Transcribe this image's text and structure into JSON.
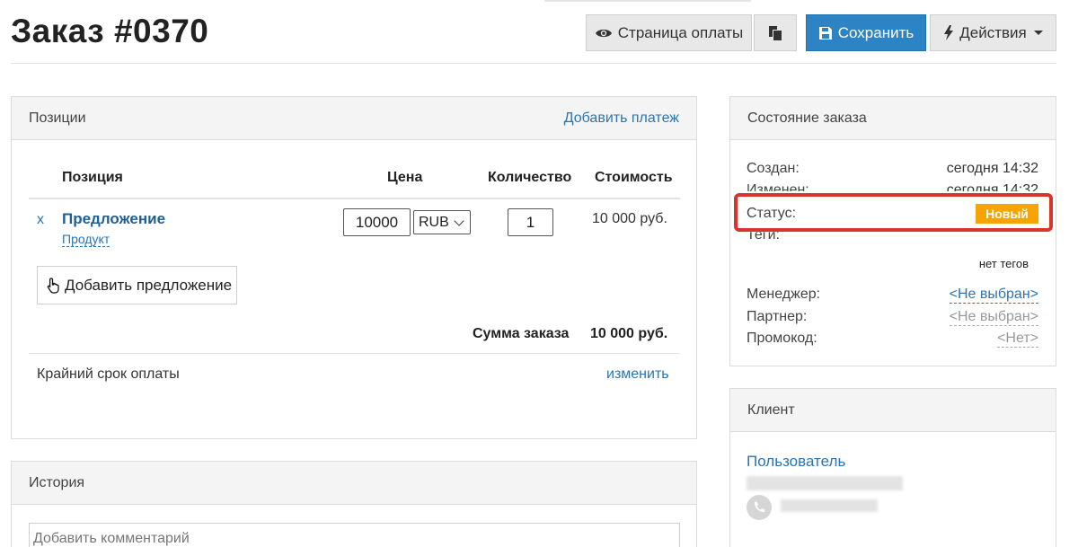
{
  "page": {
    "title": "Заказ #0370"
  },
  "toolbar": {
    "pay_page_label": "Страница оплаты",
    "save_label": "Сохранить",
    "actions_label": "Действия"
  },
  "items_panel": {
    "title": "Позиции",
    "add_payment_link": "Добавить платеж",
    "columns": [
      "Позиция",
      "Цена",
      "Количество",
      "Стоимость"
    ],
    "rows": [
      {
        "remove": "x",
        "name": "Предложение",
        "type": "Продукт",
        "price": "10000",
        "currency": "RUB",
        "quantity": "1",
        "cost": "10 000 руб."
      }
    ],
    "add_offer_label": "Добавить предложение",
    "total_label": "Сумма заказа",
    "total_value": "10 000 руб.",
    "deadline_label": "Крайний срок оплаты",
    "deadline_change": "изменить"
  },
  "history_panel": {
    "title": "История",
    "comment_placeholder": "Добавить комментарий"
  },
  "state_panel": {
    "title": "Состояние заказа",
    "created_label": "Создан:",
    "created_value": "сегодня 14:32",
    "changed_label": "Изменен:",
    "changed_value": "сегодня 14:32",
    "status_label": "Статус:",
    "status_value": "Новый",
    "tags_label": "Теги:",
    "tags_value": "нет тегов",
    "manager_label": "Менеджер:",
    "manager_value": "<Не выбран>",
    "partner_label": "Партнер:",
    "partner_value": "<Не выбран>",
    "promo_label": "Промокод:",
    "promo_value": "<Нет>"
  },
  "client_panel": {
    "title": "Клиент",
    "user_link": "Пользователь"
  },
  "colors": {
    "primary": "#2d84c4",
    "link": "#2a75b3",
    "status_badge": "#f7a400",
    "highlight": "#d9342b"
  },
  "icons": [
    "eye-icon",
    "copy-icon",
    "floppy-disk-icon",
    "lightning-icon",
    "caret-down-icon",
    "hand-pointer-icon",
    "phone-icon"
  ]
}
